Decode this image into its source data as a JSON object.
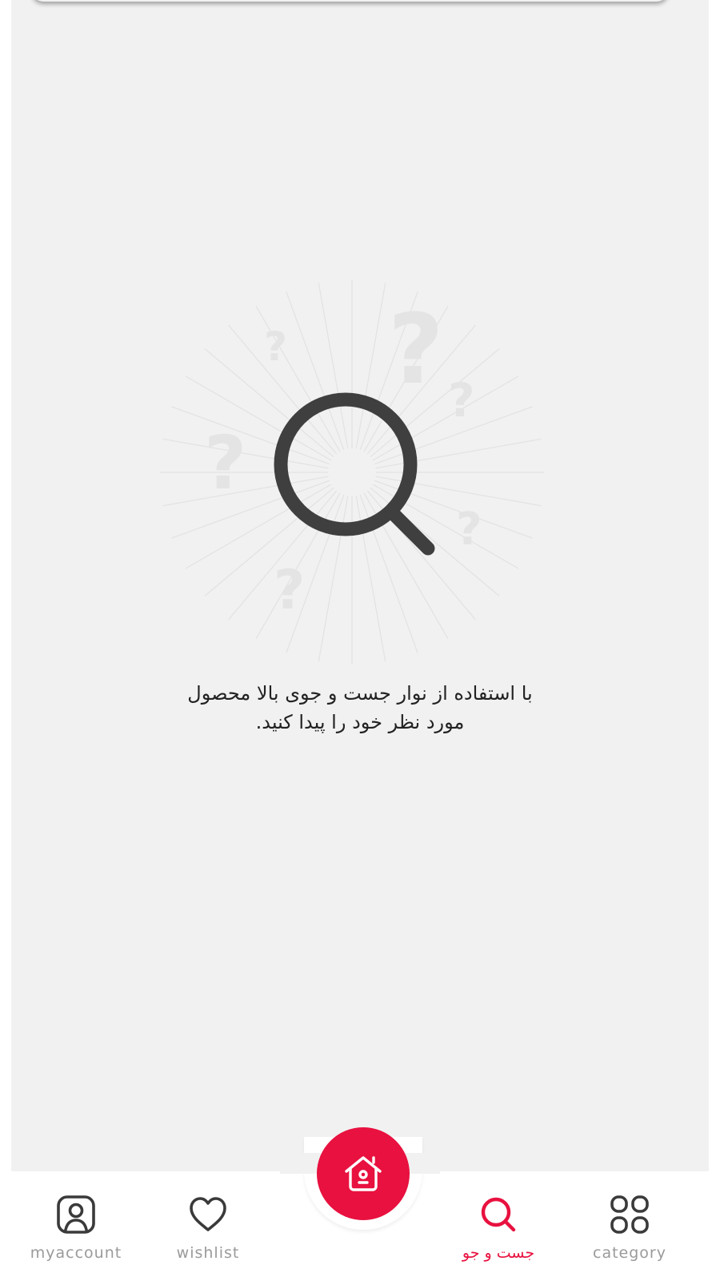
{
  "empty_state": {
    "line1": "با استفاده از نوار جست و جوی بالا محصول",
    "line2": "مورد نظر خود را پیدا کنید."
  },
  "bottom_nav": {
    "items": [
      {
        "label": "myaccount",
        "icon": "account-icon",
        "active": false
      },
      {
        "label": "wishlist",
        "icon": "heart-icon",
        "active": false
      },
      {
        "label": "جست و جو",
        "icon": "search-icon",
        "active": true
      },
      {
        "label": "category",
        "icon": "grid-icon",
        "active": false
      }
    ],
    "home_icon": "home-icon"
  },
  "colors": {
    "accent": "#e8113f",
    "background": "#f1f1f1",
    "icon_dark": "#3a3a3a",
    "label_inactive": "#9a9a9a"
  }
}
